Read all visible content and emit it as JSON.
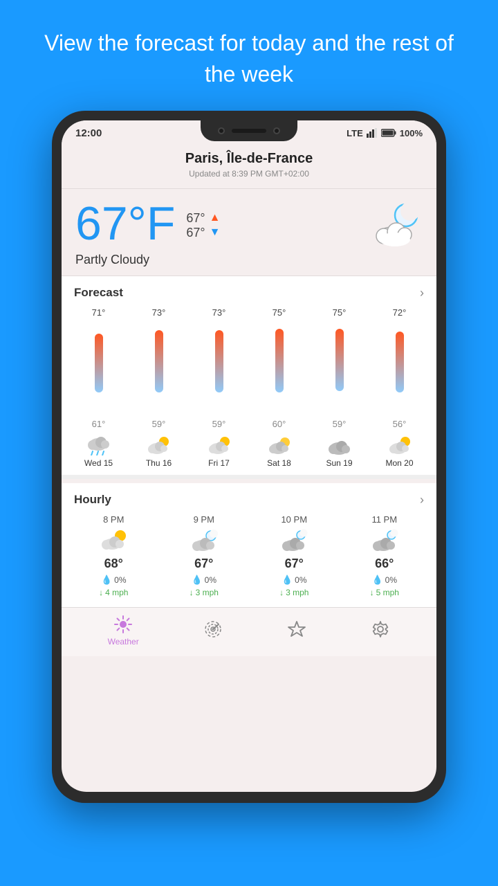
{
  "hero": {
    "headline": "View the forecast for today and the rest of the week"
  },
  "statusBar": {
    "time": "12:00",
    "network": "LTE",
    "battery": "100%"
  },
  "location": {
    "name": "Paris, Île-de-France",
    "updated": "Updated at 8:39 PM GMT+02:00"
  },
  "currentWeather": {
    "temperature": "67°F",
    "high": "67°",
    "low": "67°",
    "condition": "Partly Cloudy"
  },
  "forecast": {
    "title": "Forecast",
    "days": [
      {
        "label": "Wed 15",
        "high": "71°",
        "low": "61°",
        "icon": "rainy-cloudy",
        "barTop": 80,
        "barBottom": 50
      },
      {
        "label": "Thu 16",
        "high": "73°",
        "low": "59°",
        "icon": "partly-sunny",
        "barTop": 70,
        "barBottom": 60
      },
      {
        "label": "Fri 17",
        "high": "73°",
        "low": "59°",
        "icon": "partly-cloudy",
        "barTop": 70,
        "barBottom": 60
      },
      {
        "label": "Sat 18",
        "high": "75°",
        "low": "60°",
        "icon": "partly-cloudy",
        "barTop": 65,
        "barBottom": 62
      },
      {
        "label": "Sun 19",
        "high": "75°",
        "low": "59°",
        "icon": "cloudy",
        "barTop": 65,
        "barBottom": 60
      },
      {
        "label": "Mon 20",
        "high": "72°",
        "low": "56°",
        "icon": "partly-sunny",
        "barTop": 72,
        "barBottom": 52
      }
    ]
  },
  "hourly": {
    "title": "Hourly",
    "hours": [
      {
        "time": "8 PM",
        "icon": "partly-sunny",
        "temp": "68°",
        "precip": "0%",
        "wind": "4 mph"
      },
      {
        "time": "9 PM",
        "icon": "partly-cloudy-night",
        "temp": "67°",
        "precip": "0%",
        "wind": "3 mph"
      },
      {
        "time": "10 PM",
        "icon": "cloudy-night",
        "temp": "67°",
        "precip": "0%",
        "wind": "3 mph"
      },
      {
        "time": "11 PM",
        "icon": "cloudy-night",
        "temp": "66°",
        "precip": "0%",
        "wind": "5 mph"
      }
    ]
  },
  "nav": {
    "items": [
      {
        "id": "weather",
        "label": "Weather",
        "active": true
      },
      {
        "id": "radar",
        "label": "Radar",
        "active": false
      },
      {
        "id": "favorites",
        "label": "Favorites",
        "active": false
      },
      {
        "id": "settings",
        "label": "Settings",
        "active": false
      }
    ]
  }
}
